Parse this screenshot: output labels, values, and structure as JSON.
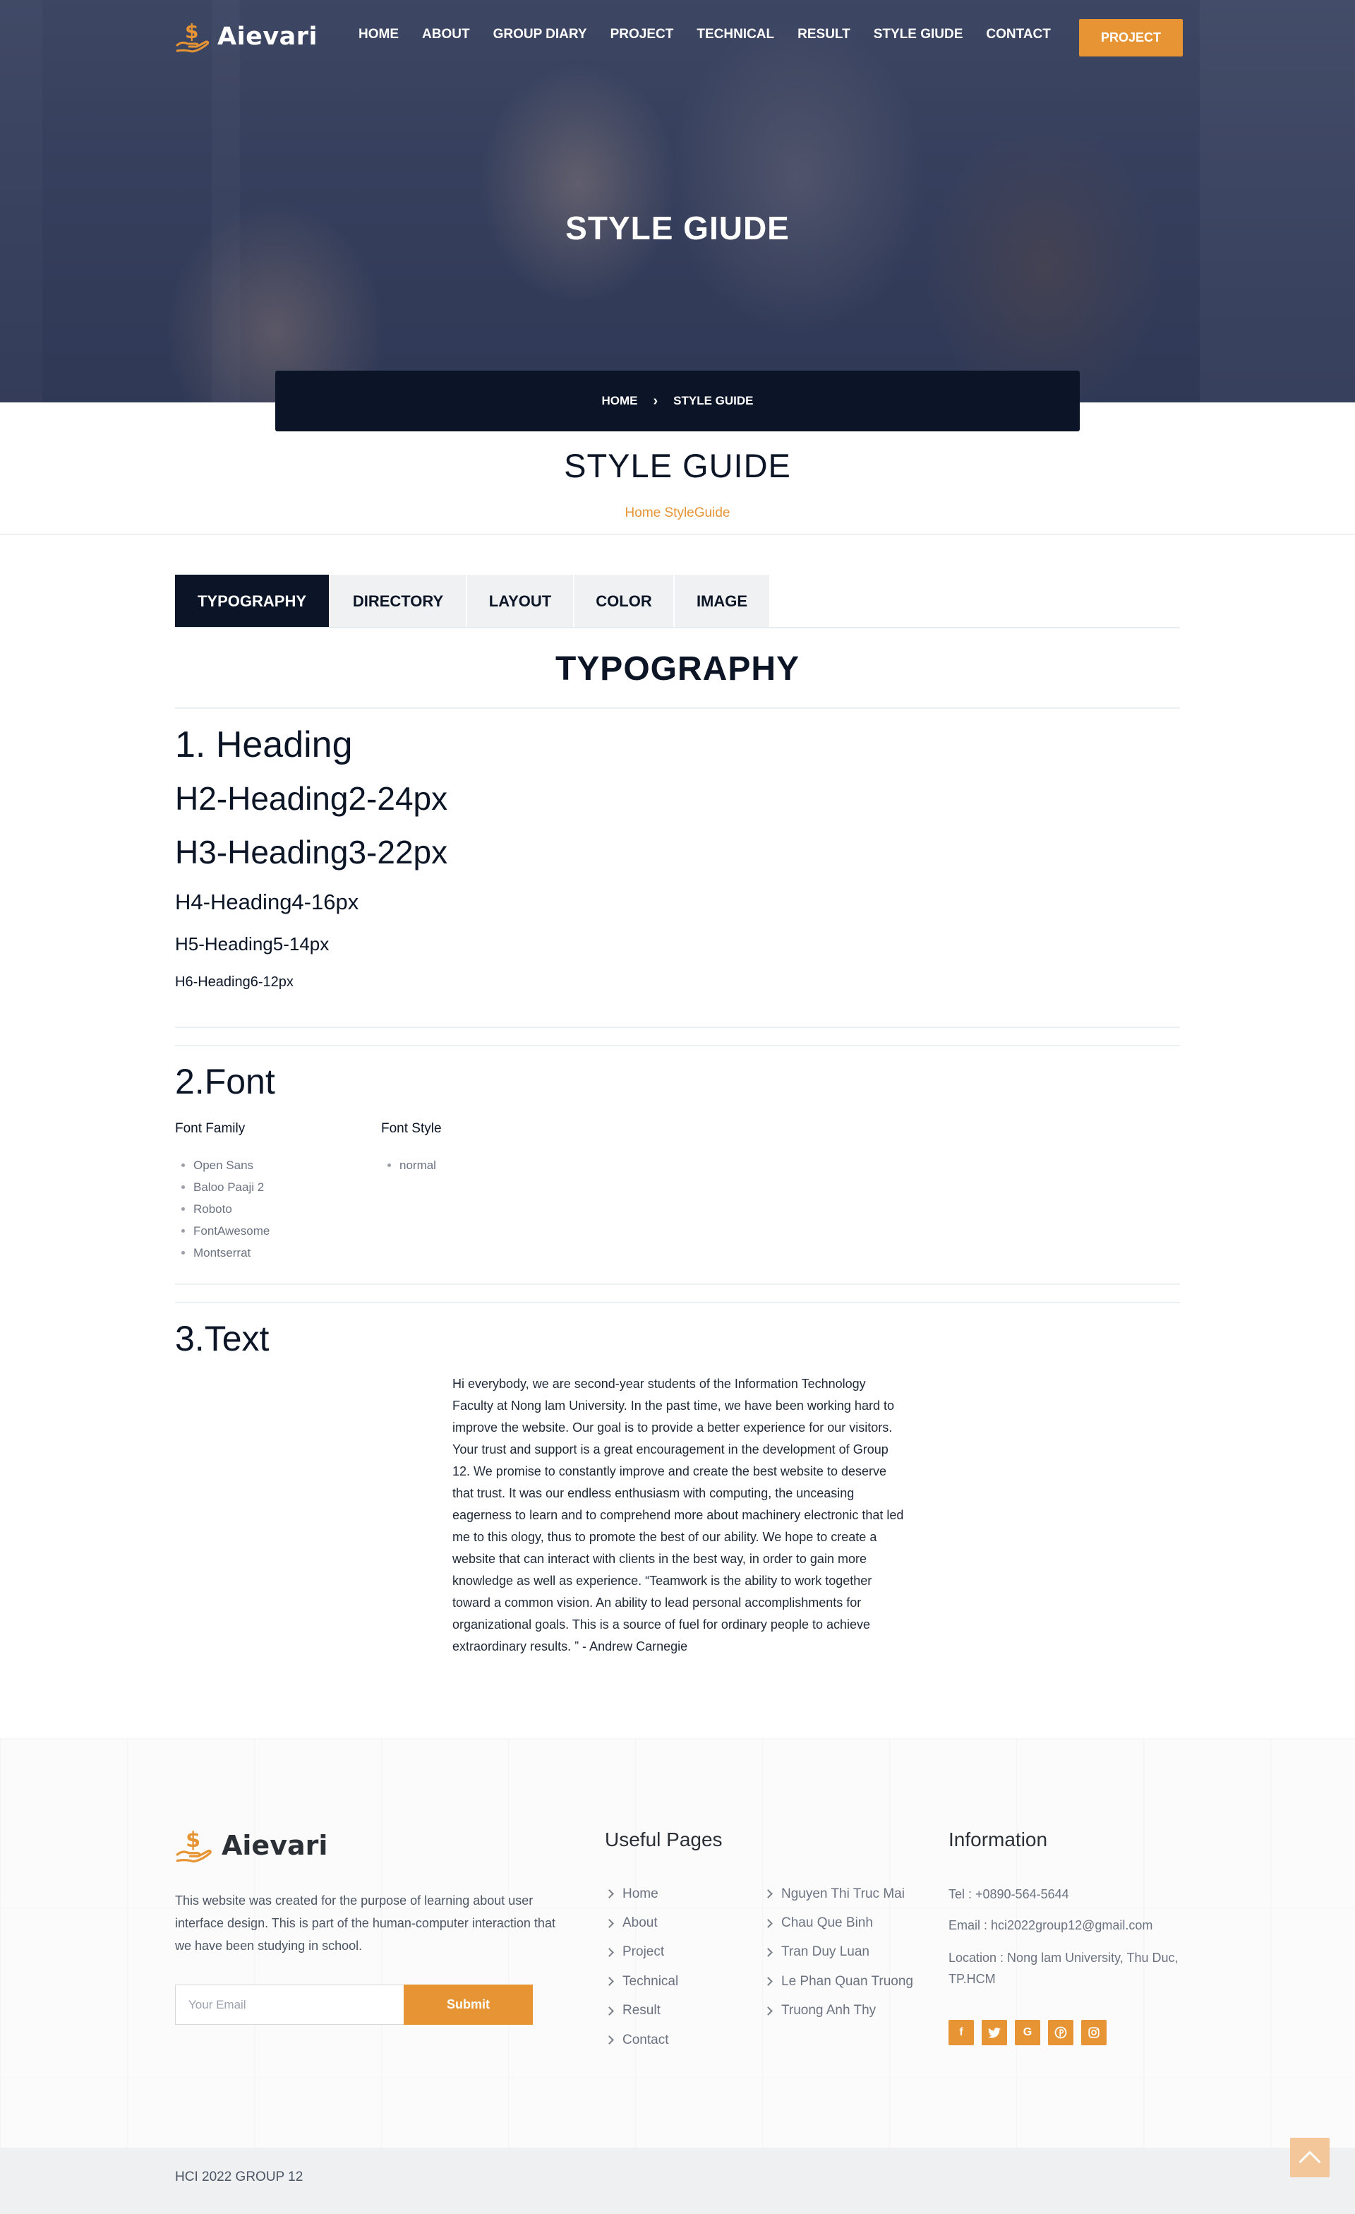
{
  "brand": {
    "name": "Aievari",
    "accent": "#e79434",
    "dark": "#0c1528",
    "logo_icon": "dollar-hand-icon"
  },
  "nav": {
    "items": [
      "HOME",
      "ABOUT",
      "GROUP DIARY",
      "PROJECT",
      "TECHNICAL",
      "RESULT",
      "STYLE GIUDE",
      "CONTACT"
    ],
    "cta": "PROJECT"
  },
  "hero": {
    "title": "STYLE GIUDE",
    "breadcrumb": {
      "home": "HOME",
      "current": "STYLE GUIDE"
    }
  },
  "page": {
    "title": "STYLE GUIDE",
    "subtitle": "Home StyleGuide"
  },
  "tabs": [
    "TYPOGRAPHY",
    "DIRECTORY",
    "LAYOUT",
    "COLOR",
    "IMAGE"
  ],
  "typography": {
    "section_title": "TYPOGRAPHY",
    "h1": "1. Heading",
    "h2": "H2-Heading2-24px",
    "h3": "H3-Heading3-22px",
    "h4": "H4-Heading4-16px",
    "h5": "H5-Heading5-14px",
    "h6": "H6-Heading6-12px"
  },
  "font": {
    "title": "2.Font",
    "family_label": "Font Family",
    "families": [
      "Open Sans",
      "Baloo Paaji 2",
      "Roboto",
      "FontAwesome",
      "Montserrat"
    ],
    "style_label": "Font Style",
    "styles": [
      "normal"
    ]
  },
  "text": {
    "title": "3.Text",
    "body": "Hi everybody, we are second-year students of the Information Technology Faculty at Nong lam University. In the past time, we have been working hard to improve the website. Our goal is to provide a better experience for our visitors. Your trust and support is a great encouragement in the development of Group 12. We promise to constantly improve and create the best website to deserve that trust. It was our endless enthusiasm with computing, the unceasing eagerness to learn and to comprehend more about machinery electronic that led me to this ology, thus to promote the best of our ability. We hope to create a website that can interact with clients in the best way, in order to gain more knowledge as well as experience. “Teamwork is the ability to work together toward a common vision. An ability to lead personal accomplishments for organizational goals. This is a source of fuel for ordinary people to achieve extraordinary results. ” - Andrew Carnegie"
  },
  "footer": {
    "brand": "Aievari",
    "description": "This website was created for the purpose of learning about user interface design. This is part of the human-computer interaction that we have been studying in school.",
    "email_placeholder": "Your Email",
    "submit": "Submit",
    "useful_title": "Useful Pages",
    "pages": [
      "Home",
      "About",
      "Project",
      "Technical",
      "Result",
      "Contact"
    ],
    "members": [
      "Nguyen Thi Truc Mai",
      "Chau Que Binh",
      "Tran Duy Luan",
      "Le Phan Quan Truong",
      "Truong Anh Thy"
    ],
    "info_title": "Information",
    "tel": "Tel : +0890-564-5644",
    "email": "Email : hci2022group12@gmail.com",
    "location": "Location : Nong lam University, Thu Duc, TP.HCM",
    "socials": [
      "facebook-icon",
      "twitter-icon",
      "google-icon",
      "pinterest-icon",
      "instagram-icon"
    ],
    "copyright": "HCI 2022 GROUP 12"
  }
}
